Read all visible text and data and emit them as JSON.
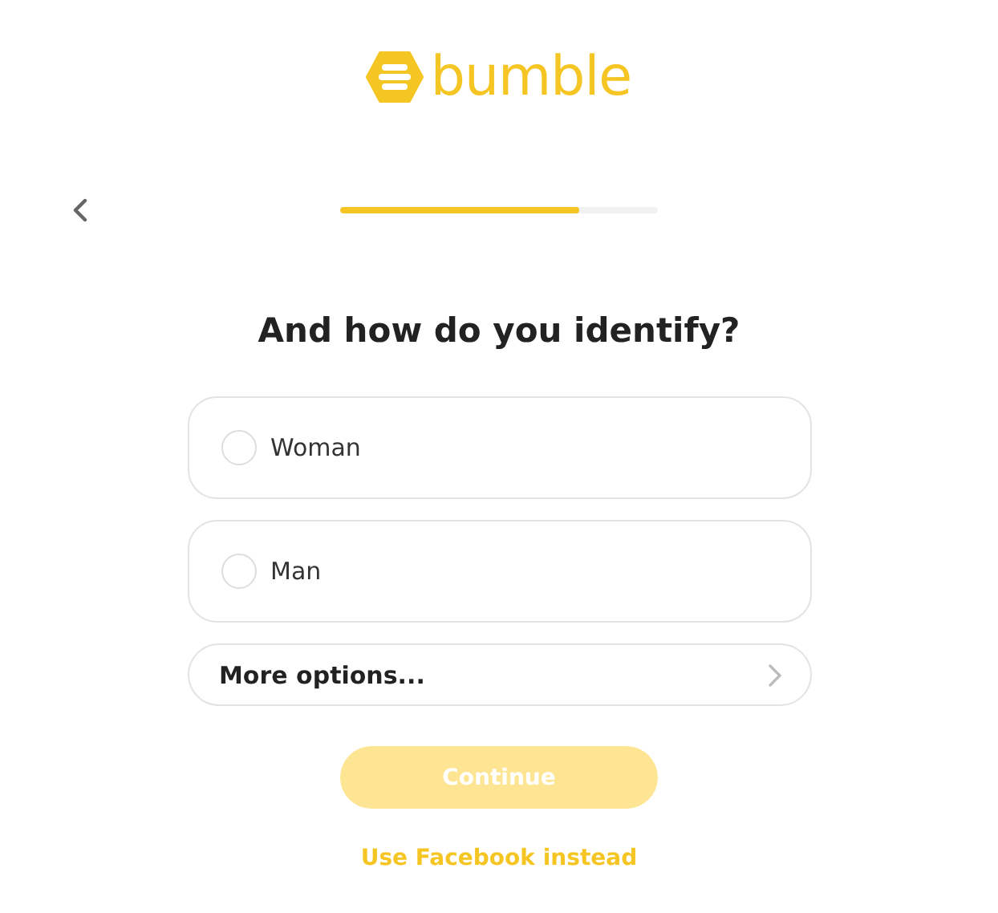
{
  "logo": {
    "text": "bumble"
  },
  "progress": {
    "level": 0.75
  },
  "title": "And how do you identify?",
  "options": [
    {
      "label": "Woman",
      "selected": false
    },
    {
      "label": "Man",
      "selected": false
    }
  ],
  "more_options": {
    "label": "More options..."
  },
  "continue_button": {
    "label": "Continue",
    "disabled": true
  },
  "alt_link": "Use Facebook instead"
}
